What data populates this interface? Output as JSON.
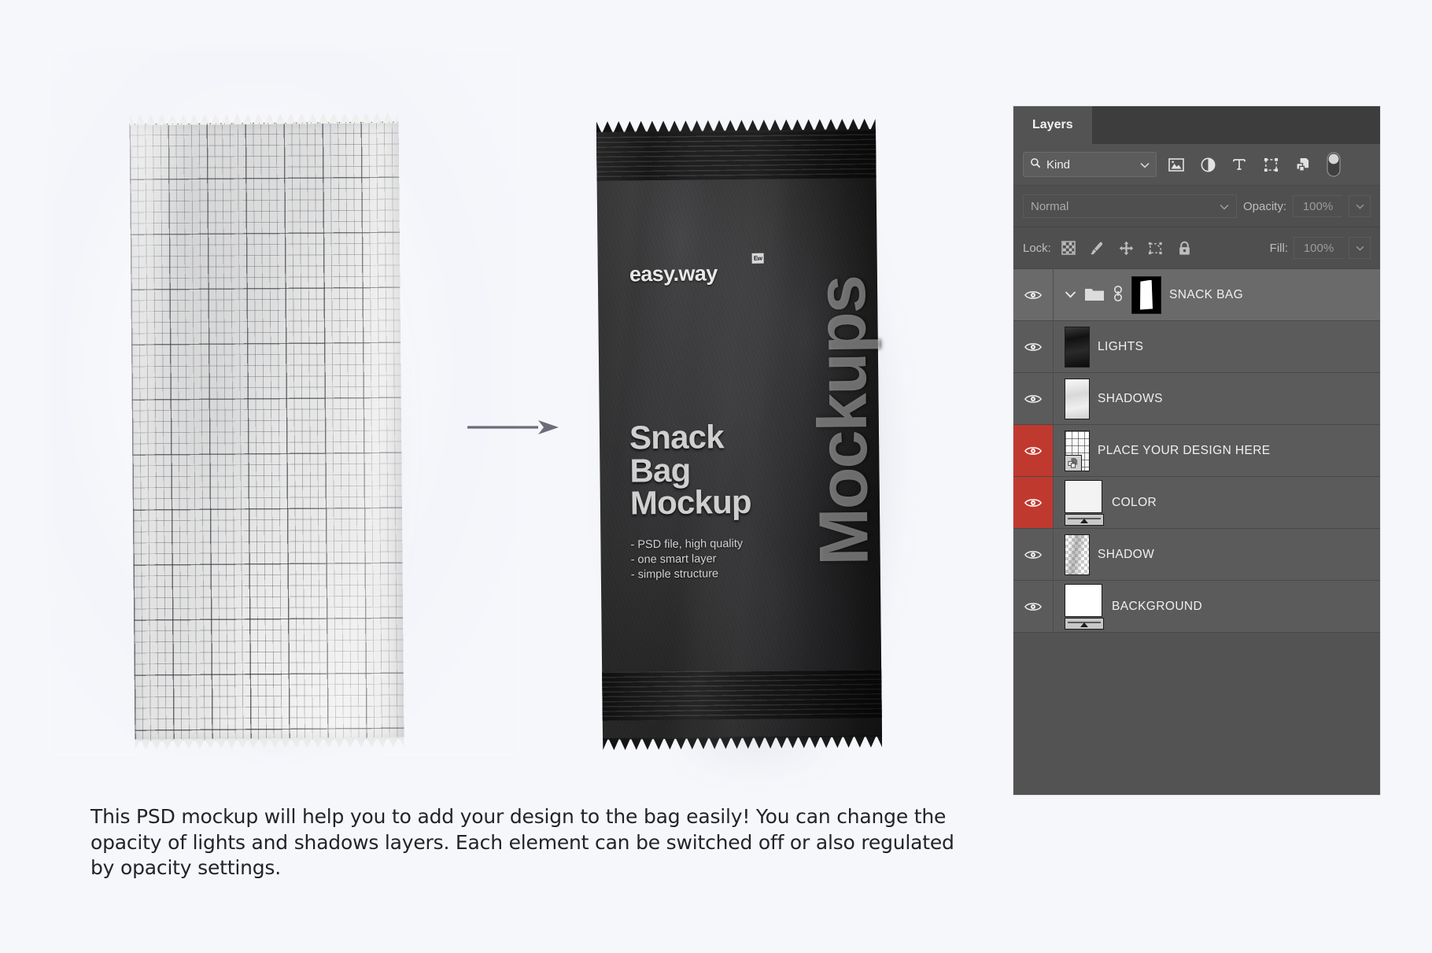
{
  "canvas": {
    "background_color": "#f6f7fb",
    "arrow_color": "#6b6d78"
  },
  "left_mockup": {
    "name": "grid-template-snack-bag",
    "description": "Blank grid-paper snack bag template"
  },
  "right_mockup": {
    "brand": "easy.way",
    "brand_badge": "Ew",
    "headline_line1": "Snack",
    "headline_line2": "Bag",
    "headline_line3": "Mockup",
    "bullets": [
      "- PSD file, high quality",
      "- one smart layer",
      "- simple structure"
    ],
    "vertical_text": "Mockups"
  },
  "caption": {
    "text": "This PSD mockup will help you to add your design to the bag easily!  You can change the opacity of lights and shadows layers. Each element can be switched off or also regulated by opacity settings."
  },
  "layers_panel": {
    "tab_label": "Layers",
    "filter": {
      "kind_label": "Kind",
      "icons": [
        "pixel-layer-filter-icon",
        "adjustment-layer-filter-icon",
        "type-layer-filter-icon",
        "shape-layer-filter-icon",
        "smart-object-filter-icon",
        "filter-toggle-switch"
      ]
    },
    "blend": {
      "mode": "Normal",
      "opacity_label": "Opacity:",
      "opacity_value": "100%"
    },
    "lock": {
      "label": "Lock:",
      "fill_label": "Fill:",
      "fill_value": "100%",
      "icons": [
        "lock-transparent-pixels-icon",
        "lock-image-pixels-icon",
        "lock-position-icon",
        "lock-artboard-nesting-icon",
        "lock-all-icon"
      ]
    },
    "selected_color": "#c0392f",
    "layers": [
      {
        "name": "SNACK BAG",
        "type": "group",
        "visible": true,
        "selected": true,
        "highlighted": false,
        "thumb": "layer-mask-thumbnail"
      },
      {
        "name": "LIGHTS",
        "type": "pixel",
        "visible": true,
        "selected": false,
        "highlighted": false,
        "thumb": "lights-thumbnail"
      },
      {
        "name": "SHADOWS",
        "type": "pixel",
        "visible": true,
        "selected": false,
        "highlighted": false,
        "thumb": "shadows-thumbnail"
      },
      {
        "name": "PLACE YOUR DESIGN HERE",
        "type": "smart-object",
        "visible": true,
        "selected": false,
        "highlighted": true,
        "thumb": "design-thumbnail"
      },
      {
        "name": "COLOR",
        "type": "solid-fill",
        "visible": true,
        "selected": false,
        "highlighted": true,
        "thumb": "solid-color-thumbnail"
      },
      {
        "name": "SHADOW",
        "type": "pixel",
        "visible": true,
        "selected": false,
        "highlighted": false,
        "thumb": "transparency-thumbnail"
      },
      {
        "name": "BACKGROUND",
        "type": "solid-fill",
        "visible": true,
        "selected": false,
        "highlighted": false,
        "thumb": "background-thumbnail"
      }
    ]
  }
}
